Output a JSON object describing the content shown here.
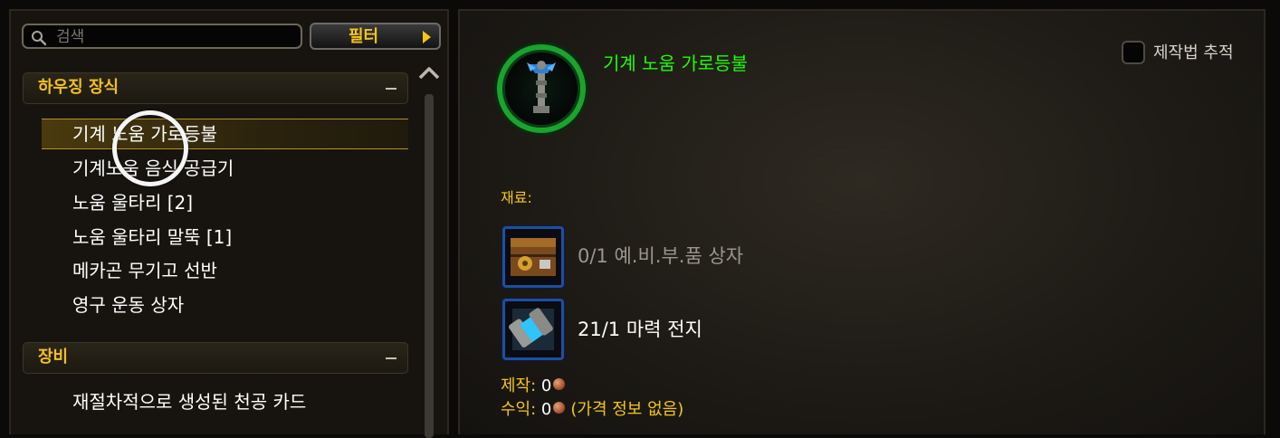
{
  "search": {
    "placeholder": "검색"
  },
  "filter": {
    "label": "필터"
  },
  "categories": [
    {
      "label": "하우징 장식",
      "items": [
        {
          "label": "기계 노움 가로등불",
          "selected": true
        },
        {
          "label": "기계노움 음식 공급기"
        },
        {
          "label": "노움 울타리 [2]"
        },
        {
          "label": "노움 울타리 말뚝 [1]"
        },
        {
          "label": "메카곤 무기고 선반"
        },
        {
          "label": "영구 운동 상자"
        }
      ]
    },
    {
      "label": "장비",
      "items": [
        {
          "label": "재절차적으로 생성된 천공 카드"
        }
      ]
    }
  ],
  "detail": {
    "title": "기계 노움 가로등불",
    "title_color": "#1eff00",
    "track_label": "제작법 추적",
    "materials_label": "재료:",
    "reagents": [
      {
        "text": "0/1 예.비.부.품 상자",
        "color": "#9b968c",
        "icon": "crate-icon"
      },
      {
        "text": "21/1 마력 전지",
        "color": "#ffffff",
        "icon": "power-cell-icon"
      }
    ],
    "craft": {
      "label": "제작:",
      "value": "0"
    },
    "profit": {
      "label": "수익:",
      "value": "0",
      "note": "(가격 정보 없음)"
    }
  },
  "colors": {
    "accent_gold": "#f5c617",
    "quality_green": "#1eff00",
    "panel_bg": "#17140f"
  }
}
